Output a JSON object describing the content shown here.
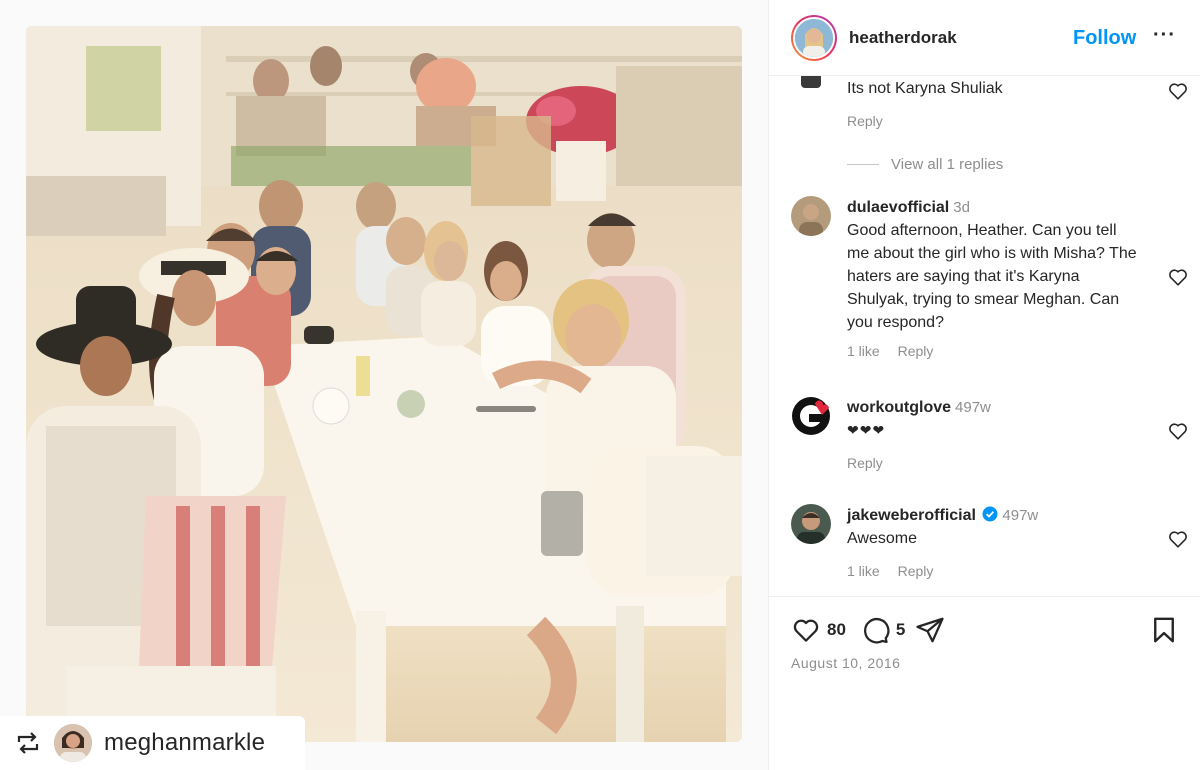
{
  "post": {
    "username": "heatherdorak",
    "follow_label": "Follow",
    "more_label": "···",
    "repost_username": "meghanmarkle",
    "likes_count": "80",
    "comments_count": "5",
    "date": "August 10, 2016"
  },
  "comments": [
    {
      "username": "",
      "time": "",
      "text": "Its not Karyna Shuliak",
      "likes": "",
      "reply_label": "Reply",
      "view_replies": "View all 1 replies"
    },
    {
      "username": "dulaevofficial",
      "time": "3d",
      "text": "Good afternoon, Heather. Can you tell me about the girl who is with Misha? The haters are saying that it's Karyna Shulyak, trying to smear Meghan. Can you respond?",
      "likes": "1 like",
      "reply_label": "Reply"
    },
    {
      "username": "workoutglove",
      "time": "497w",
      "text": "❤❤❤",
      "likes": "",
      "reply_label": "Reply"
    },
    {
      "username": "jakeweberofficial",
      "time": "497w",
      "text": "Awesome",
      "likes": "1 like",
      "reply_label": "Reply"
    }
  ],
  "colors": {
    "follow": "#0095f6",
    "verified": "#0095f6",
    "text": "#262626",
    "muted": "#8e8e8e"
  },
  "icons": {
    "repost": "repost-icon",
    "like": "heart-icon",
    "comment": "comment-icon",
    "share": "send-icon",
    "save": "bookmark-icon",
    "verified": "verified-badge-icon"
  }
}
